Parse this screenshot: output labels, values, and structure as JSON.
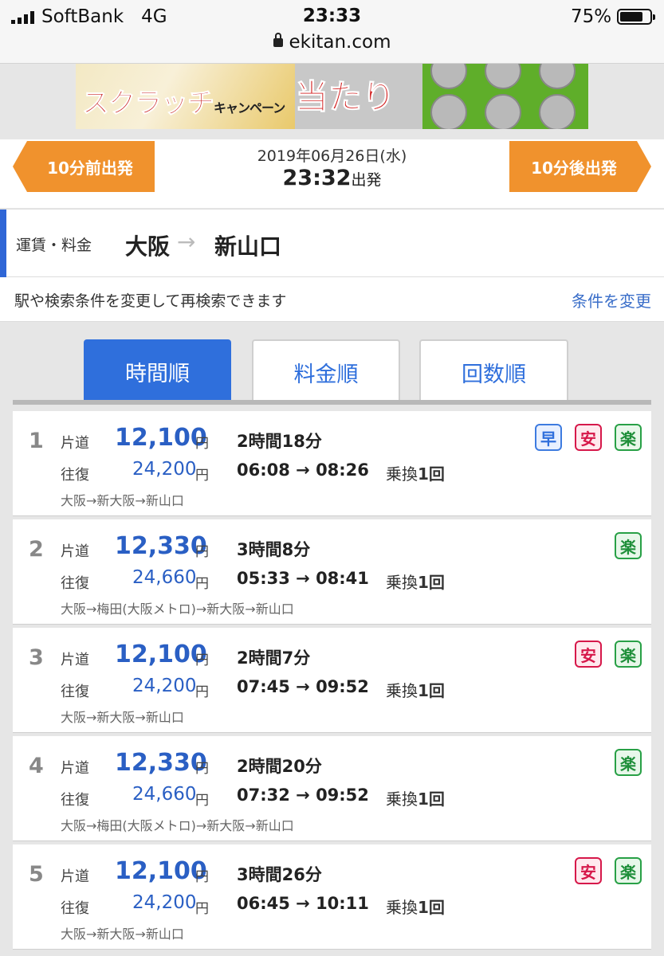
{
  "status_bar": {
    "carrier": "SoftBank",
    "network": "4G",
    "time": "23:33",
    "battery": "75%",
    "url": "ekitan.com"
  },
  "ad_banner": {
    "title_main": "スクラッチ",
    "title_sub": "キャンペーン",
    "hit_text": "当たり"
  },
  "departure": {
    "prev_button": "10分前出発",
    "next_button": "10分後出発",
    "date": "2019年06月26日(水)",
    "time": "23:32",
    "time_suffix": "出発"
  },
  "route": {
    "label": "運賃・料金",
    "from": "大阪",
    "arrow": "→",
    "to": "新山口"
  },
  "condition": {
    "text": "駅や検索条件を変更して再検索できます",
    "link": "条件を変更"
  },
  "tabs": [
    {
      "label": "時間順",
      "active": true
    },
    {
      "label": "料金順",
      "active": false
    },
    {
      "label": "回数順",
      "active": false
    }
  ],
  "labels": {
    "one_way": "片道",
    "round_trip": "往復",
    "yen": "円",
    "transfer": "乗換",
    "badge_fast": "早",
    "badge_cheap": "安",
    "badge_easy": "楽"
  },
  "results": [
    {
      "rank": "1",
      "one_way": "12,100",
      "round_trip": "24,200",
      "duration": "2時間18分",
      "times": "06:08 → 08:26",
      "transfers": "1回",
      "path": "大阪→新大阪→新山口",
      "badges": [
        "fast",
        "cheap",
        "easy"
      ]
    },
    {
      "rank": "2",
      "one_way": "12,330",
      "round_trip": "24,660",
      "duration": "3時間8分",
      "times": "05:33 → 08:41",
      "transfers": "1回",
      "path": "大阪→梅田(大阪メトロ)→新大阪→新山口",
      "badges": [
        "easy"
      ]
    },
    {
      "rank": "3",
      "one_way": "12,100",
      "round_trip": "24,200",
      "duration": "2時間7分",
      "times": "07:45 → 09:52",
      "transfers": "1回",
      "path": "大阪→新大阪→新山口",
      "badges": [
        "cheap",
        "easy"
      ]
    },
    {
      "rank": "4",
      "one_way": "12,330",
      "round_trip": "24,660",
      "duration": "2時間20分",
      "times": "07:32 → 09:52",
      "transfers": "1回",
      "path": "大阪→梅田(大阪メトロ)→新大阪→新山口",
      "badges": [
        "easy"
      ]
    },
    {
      "rank": "5",
      "one_way": "12,100",
      "round_trip": "24,200",
      "duration": "3時間26分",
      "times": "06:45 → 10:11",
      "transfers": "1回",
      "path": "大阪→新大阪→新山口",
      "badges": [
        "cheap",
        "easy"
      ]
    }
  ],
  "colors": {
    "accent_blue": "#2f6fdc",
    "orange": "#f0922d",
    "badge_fast": "#3d7be0",
    "badge_cheap": "#d6184a",
    "badge_easy": "#28a046"
  }
}
